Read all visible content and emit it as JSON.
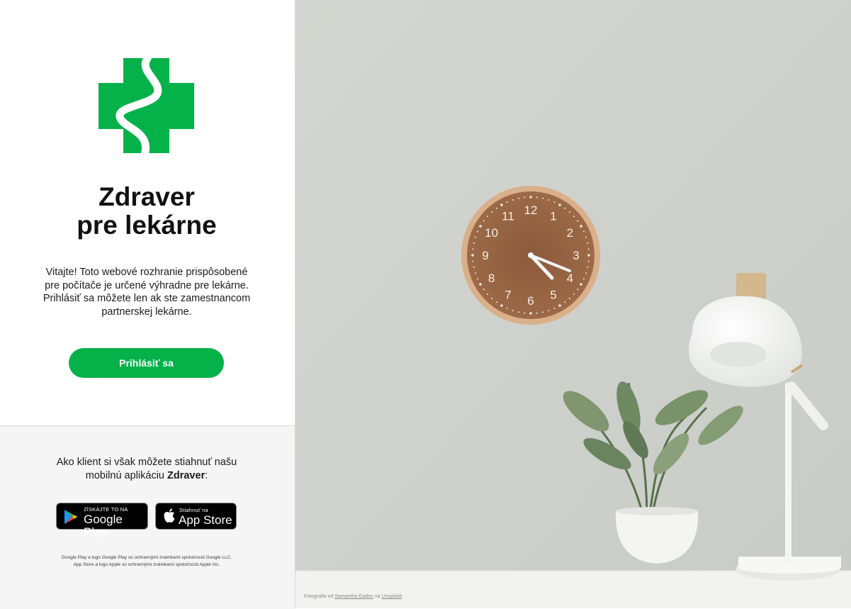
{
  "brand": {
    "title_line1": "Zdraver",
    "title_line2": "pre lekárne",
    "color": "#05b24a"
  },
  "welcome_text": "Vitajte! Toto webové rozhranie prispôsobené pre počítače je určené výhradne pre lekárne. Prihlásiť sa môžete len ak ste zamestnancom partnerskej lekárne.",
  "login_button": "Prihlásiť sa",
  "client": {
    "text_before": "Ako klient si však môžete stiahnuť našu mobilnú aplikáciu ",
    "app_name": "Zdraver",
    "text_after": ":"
  },
  "badges": {
    "google_play": {
      "small": "ZÍSKAJTE TO NA",
      "big": "Google Play",
      "icon": "google-play-icon"
    },
    "app_store": {
      "small": "Stiahnuť na",
      "big": "App Store",
      "icon": "apple-icon"
    }
  },
  "legal": {
    "line1": "Google Play a logo Google Play sú ochrannými známkami spoločnosti Google LLC.",
    "line2": "App Store a logo Apple sú ochrannými známkami spoločnosti Apple Inc."
  },
  "photo_credit": {
    "prefix": "Fotografia od",
    "author": "Samantha Gades",
    "middle": "na",
    "source": "Unsplash"
  },
  "clock_numbers": [
    "12",
    "1",
    "2",
    "3",
    "4",
    "5",
    "6",
    "7",
    "8",
    "9",
    "10",
    "11"
  ]
}
